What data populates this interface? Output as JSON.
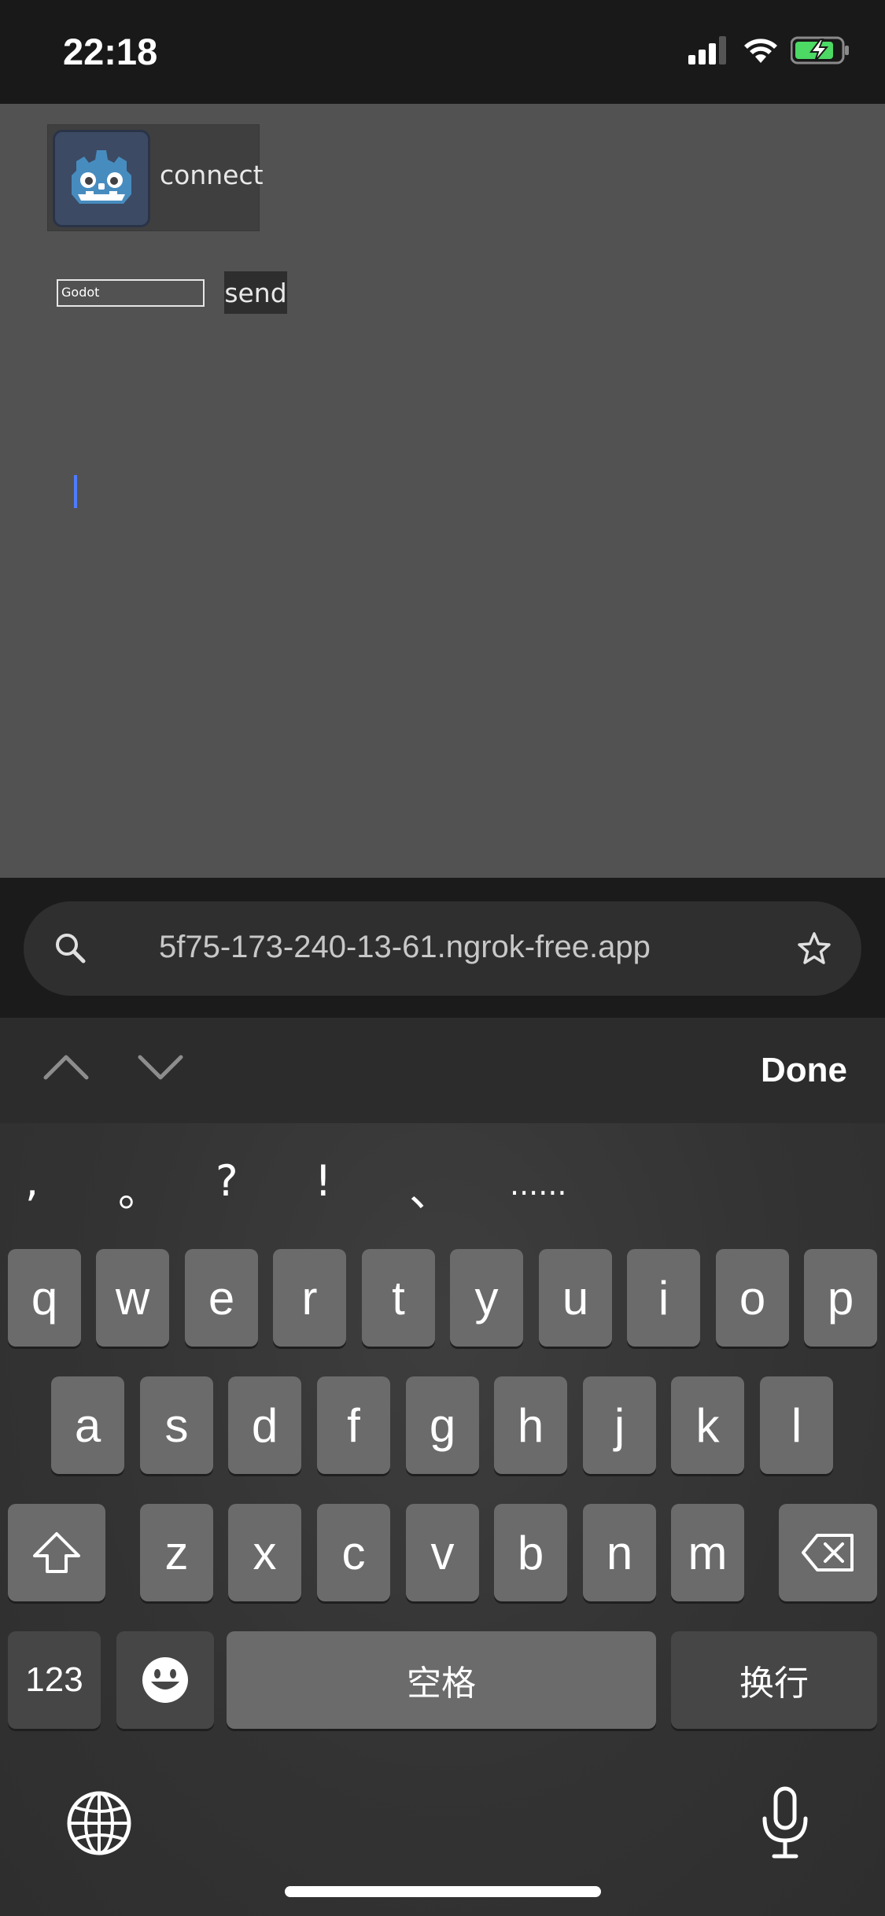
{
  "status_bar": {
    "time": "22:18"
  },
  "page": {
    "connect_label": "connect",
    "name_input_value": "Godot",
    "send_label": "send"
  },
  "address_bar": {
    "url": "5f75-173-240-13-61.ngrok-free.app"
  },
  "accessory_bar": {
    "done_label": "Done"
  },
  "keyboard": {
    "candidates": [
      ",",
      "。",
      "?",
      "!",
      "、",
      "......"
    ],
    "row1": [
      "q",
      "w",
      "e",
      "r",
      "t",
      "y",
      "u",
      "i",
      "o",
      "p"
    ],
    "row2": [
      "a",
      "s",
      "d",
      "f",
      "g",
      "h",
      "j",
      "k",
      "l"
    ],
    "row3": [
      "z",
      "x",
      "c",
      "v",
      "b",
      "n",
      "m"
    ],
    "numbers_label": "123",
    "space_label": "空格",
    "return_label": "换行"
  },
  "icons": {
    "battery_color": "#4cd964",
    "caret_color": "#4f7bff",
    "godot_color": "#478cbf"
  }
}
